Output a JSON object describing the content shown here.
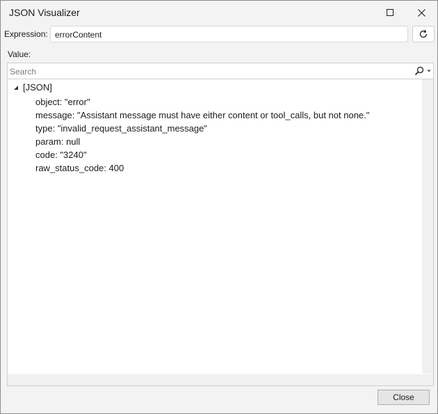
{
  "window": {
    "title": "JSON Visualizer"
  },
  "expression": {
    "label": "Expression:",
    "value": "errorContent"
  },
  "value_section": {
    "label": "Value:"
  },
  "search": {
    "placeholder": "Search"
  },
  "tree": {
    "root_label": "[JSON]",
    "expanded": true,
    "items": [
      {
        "text": "object: \"error\""
      },
      {
        "text": "message: \"Assistant message must have either content or tool_calls, but not none.\""
      },
      {
        "text": "type: \"invalid_request_assistant_message\""
      },
      {
        "text": "param: null"
      },
      {
        "text": "code: \"3240\""
      },
      {
        "text": "raw_status_code: 400"
      }
    ]
  },
  "footer": {
    "close_label": "Close"
  },
  "icons": {
    "maximize": "maximize-icon",
    "close": "close-icon",
    "refresh": "refresh-icon",
    "search": "search-icon",
    "dropdown": "chevron-down-icon",
    "expand": "expand-arrow-icon"
  }
}
